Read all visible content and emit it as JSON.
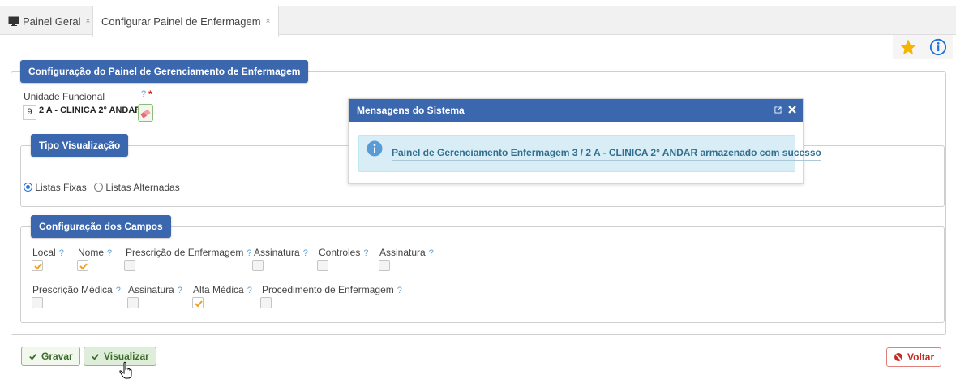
{
  "tabs": [
    {
      "label": "Painel Geral",
      "icon": "monitor-icon"
    },
    {
      "label": "Configurar Painel de Enfermagem",
      "icon": null
    }
  ],
  "tab_close": "×",
  "colors": {
    "primary": "#3a67ad",
    "star": "#f5b400",
    "info": "#1e6fd9",
    "success": "#3c6e2a",
    "danger": "#c62a23"
  },
  "config_panel": {
    "title": "Configuração do Painel de Gerenciamento de Enfermagem"
  },
  "unidade": {
    "label": "Unidade Funcional",
    "help": "?",
    "required": "*",
    "code": "9",
    "name": "2 A - CLINICA 2° ANDAR"
  },
  "tipo_visualizacao": {
    "title": "Tipo Visualização",
    "options": [
      {
        "label": "Listas Fixas",
        "selected": true
      },
      {
        "label": "Listas Alternadas",
        "selected": false
      }
    ]
  },
  "campos": {
    "title": "Configuração dos Campos",
    "help": "?",
    "row1": [
      {
        "label": "Local",
        "checked": true
      },
      {
        "label": "Nome",
        "checked": true
      },
      {
        "label": "Prescrição de Enfermagem",
        "checked": false
      },
      {
        "label": "Assinatura",
        "checked": false
      },
      {
        "label": "Controles",
        "checked": false
      },
      {
        "label": "Assinatura",
        "checked": false
      }
    ],
    "row2": [
      {
        "label": "Prescrição Médica",
        "checked": false
      },
      {
        "label": "Assinatura",
        "checked": false
      },
      {
        "label": "Alta Médica",
        "checked": true
      },
      {
        "label": "Procedimento de Enfermagem",
        "checked": false
      }
    ]
  },
  "buttons": {
    "gravar": "Gravar",
    "visualizar": "Visualizar",
    "voltar": "Voltar"
  },
  "modal": {
    "title": "Mensagens do Sistema",
    "message": "Painel de Gerenciamento Enfermagem 3 / 2 A - CLINICA 2° ANDAR armazenado com sucesso"
  }
}
